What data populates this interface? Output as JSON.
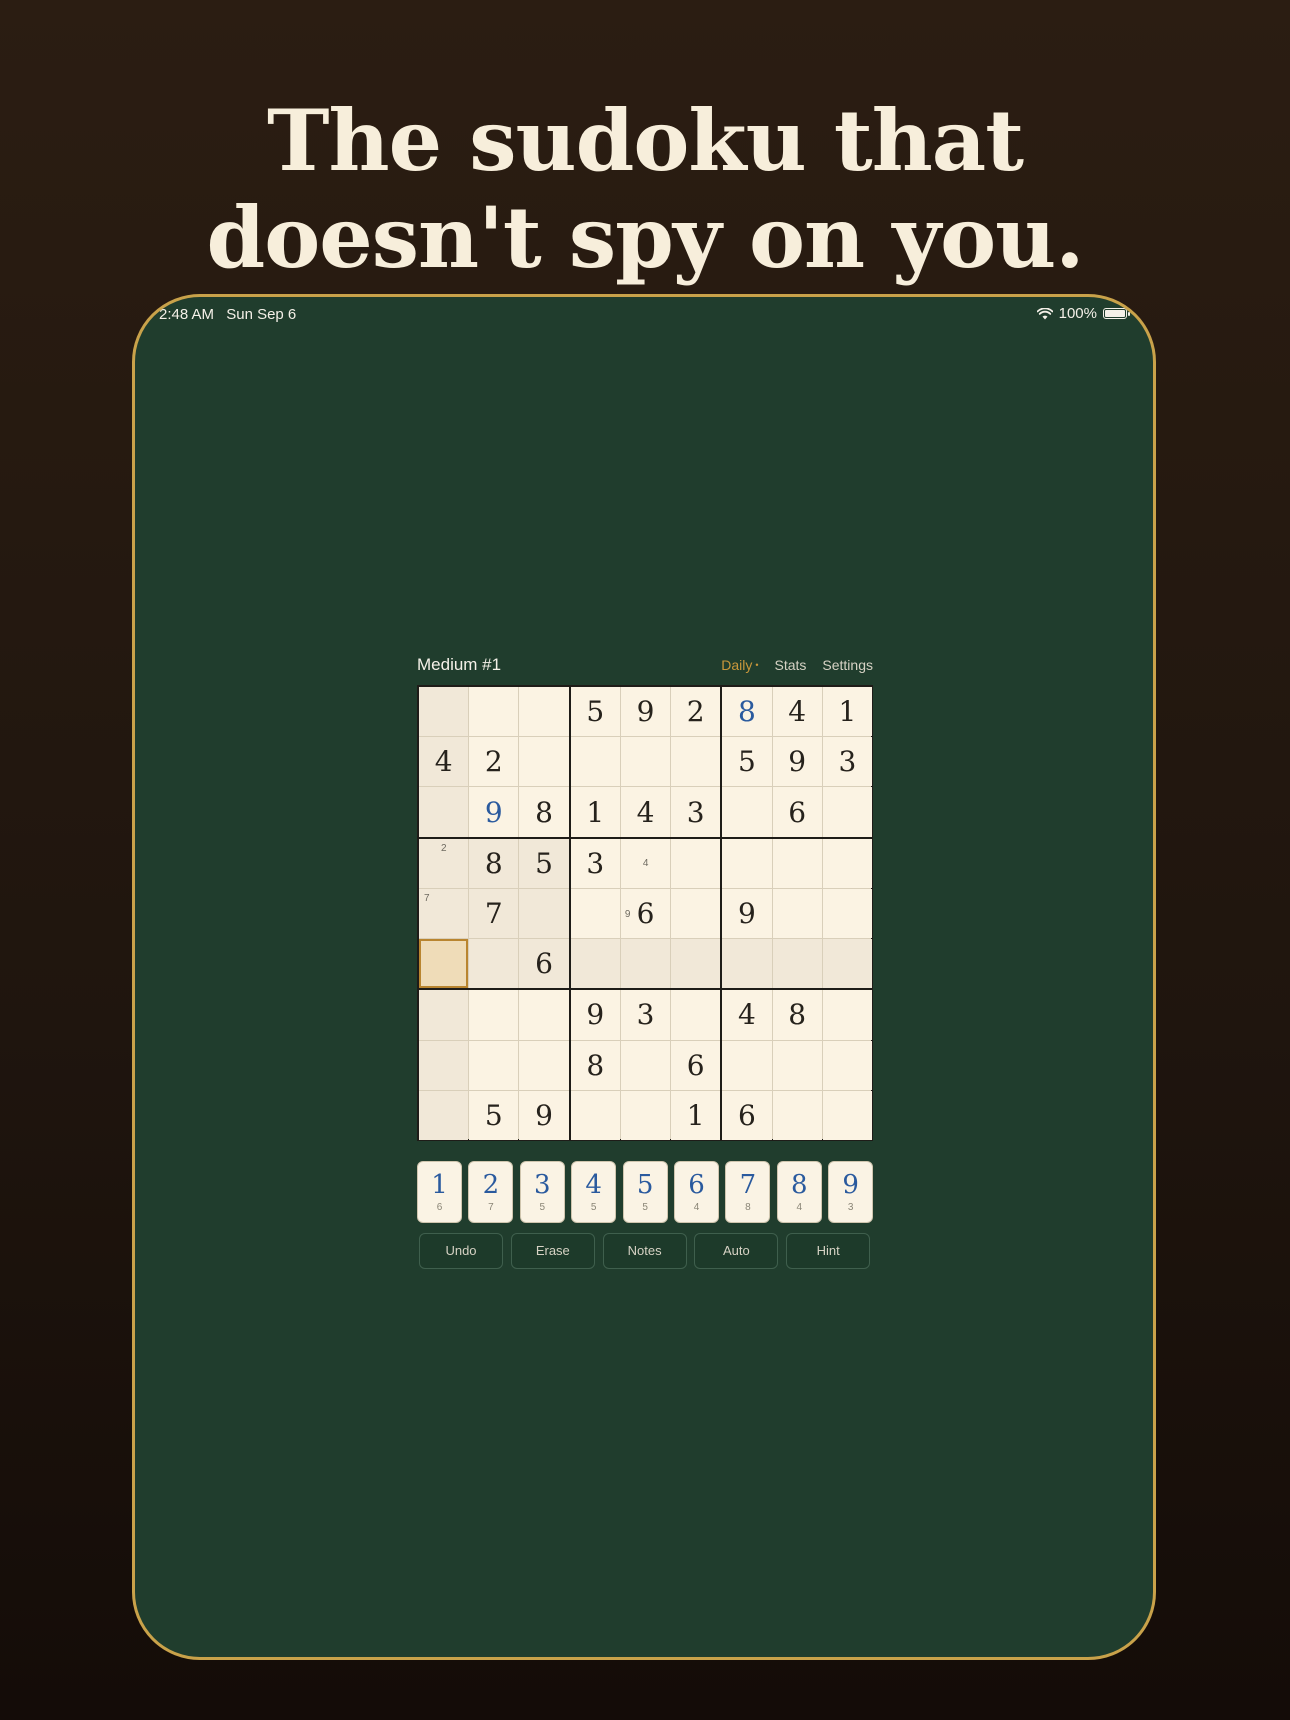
{
  "headline": {
    "line1": "The sudoku that",
    "line2": "doesn't spy on you."
  },
  "status": {
    "time": "2:48 AM",
    "date": "Sun Sep 6",
    "battery": "100%"
  },
  "game": {
    "title": "Medium #1",
    "nav": {
      "daily": "Daily",
      "dot": "•",
      "stats": "Stats",
      "settings": "Settings"
    }
  },
  "board": {
    "rows": [
      [
        null,
        null,
        null,
        {
          "v": "5"
        },
        {
          "v": "9"
        },
        {
          "v": "2"
        },
        {
          "v": "8",
          "u": true
        },
        {
          "v": "4"
        },
        {
          "v": "1"
        }
      ],
      [
        {
          "v": "4"
        },
        {
          "v": "2"
        },
        null,
        null,
        null,
        null,
        {
          "v": "5"
        },
        {
          "v": "9"
        },
        {
          "v": "3"
        }
      ],
      [
        null,
        {
          "v": "9",
          "u": true
        },
        {
          "v": "8"
        },
        {
          "v": "1"
        },
        {
          "v": "4"
        },
        {
          "v": "3"
        },
        null,
        {
          "v": "6"
        },
        null
      ],
      [
        {
          "note": "2",
          "pos": "top"
        },
        {
          "v": "8"
        },
        {
          "v": "5"
        },
        {
          "v": "3"
        },
        {
          "note": "4",
          "pos": "center"
        },
        null,
        null,
        null,
        null
      ],
      [
        {
          "note": "7",
          "pos": "topleft"
        },
        {
          "v": "7"
        },
        null,
        null,
        {
          "v": "6",
          "pin": "9"
        },
        null,
        {
          "v": "9"
        },
        null,
        null
      ],
      [
        null,
        null,
        {
          "v": "6"
        },
        null,
        null,
        null,
        null,
        null,
        null
      ],
      [
        null,
        null,
        null,
        {
          "v": "9"
        },
        {
          "v": "3"
        },
        null,
        {
          "v": "4"
        },
        {
          "v": "8"
        },
        null
      ],
      [
        null,
        null,
        null,
        {
          "v": "8"
        },
        null,
        {
          "v": "6"
        },
        null,
        null,
        null
      ],
      [
        null,
        {
          "v": "5"
        },
        {
          "v": "9"
        },
        null,
        null,
        {
          "v": "1"
        },
        {
          "v": "6"
        },
        null,
        null
      ]
    ],
    "selected": [
      5,
      0
    ],
    "colors": {
      "cell": "#fbf3e3",
      "highlight": "#f1e8d8",
      "selected": "#efdcb8",
      "selected_border": "#b9852f"
    }
  },
  "keypad": [
    {
      "digit": "1",
      "count": "6"
    },
    {
      "digit": "2",
      "count": "7"
    },
    {
      "digit": "3",
      "count": "5"
    },
    {
      "digit": "4",
      "count": "5"
    },
    {
      "digit": "5",
      "count": "5"
    },
    {
      "digit": "6",
      "count": "4"
    },
    {
      "digit": "7",
      "count": "8"
    },
    {
      "digit": "8",
      "count": "4"
    },
    {
      "digit": "9",
      "count": "3"
    }
  ],
  "actions": [
    "Undo",
    "Erase",
    "Notes",
    "Auto",
    "Hint"
  ],
  "icons": {
    "wifi": "wifi-icon",
    "battery": "battery-icon"
  }
}
